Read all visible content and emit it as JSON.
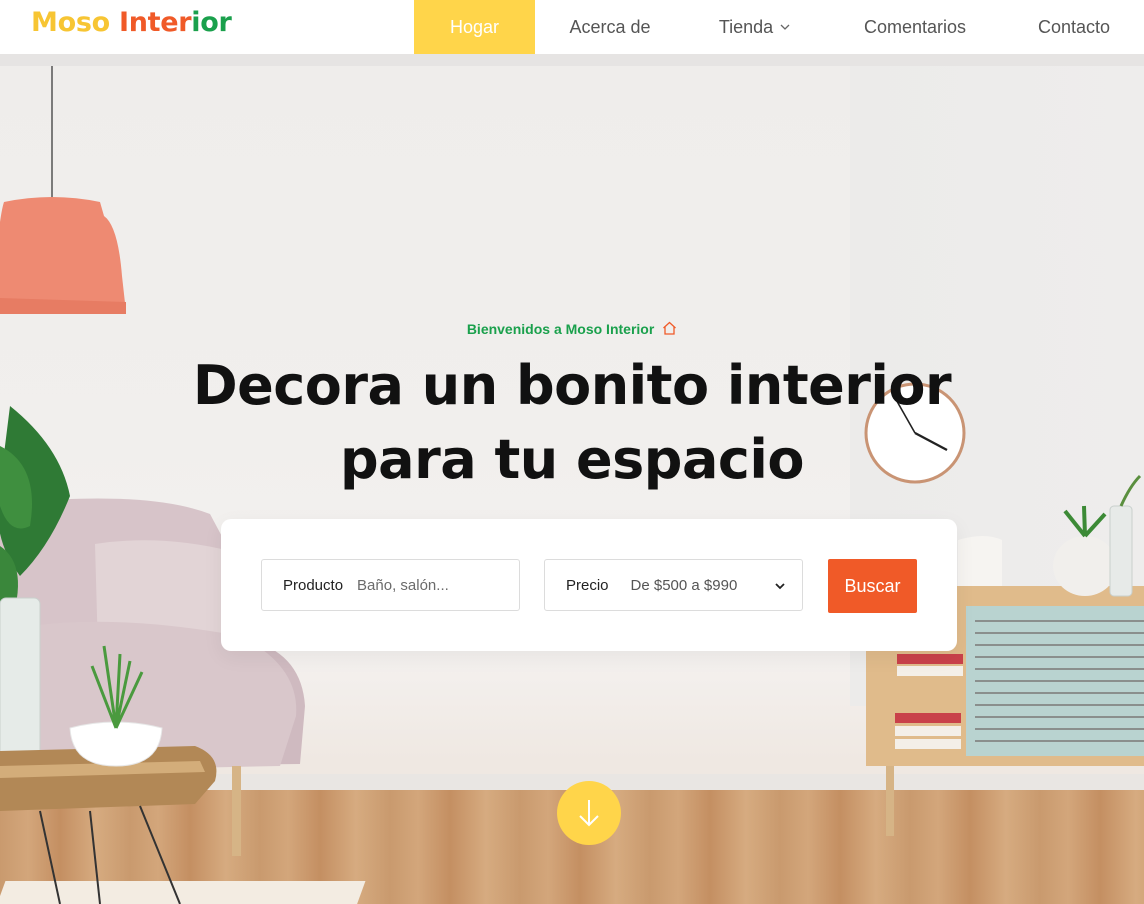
{
  "brand": {
    "part1": "Moso",
    "part2": "Inter",
    "part3": "ior"
  },
  "nav": {
    "items": [
      {
        "label": "Hogar",
        "active": true
      },
      {
        "label": "Acerca de",
        "active": false
      },
      {
        "label": "Tienda",
        "active": false,
        "dropdown": true
      },
      {
        "label": "Comentarios",
        "active": false
      },
      {
        "label": "Contacto",
        "active": false
      }
    ]
  },
  "hero": {
    "welcome": "Bienvenidos a Moso Interior",
    "headline_line1": "Decora un bonito interior",
    "headline_line2": "para tu espacio"
  },
  "search": {
    "product_label": "Producto",
    "product_placeholder": "Baño, salón...",
    "price_label": "Precio",
    "price_value": "De $500 a $990",
    "button_label": "Buscar"
  },
  "colors": {
    "yellow": "#ffd54a",
    "orange": "#f05a28",
    "green": "#1aa04c"
  },
  "icons": {
    "welcome": "home-icon",
    "dropdown": "chevron-down-icon",
    "scroll": "arrow-down-icon"
  }
}
